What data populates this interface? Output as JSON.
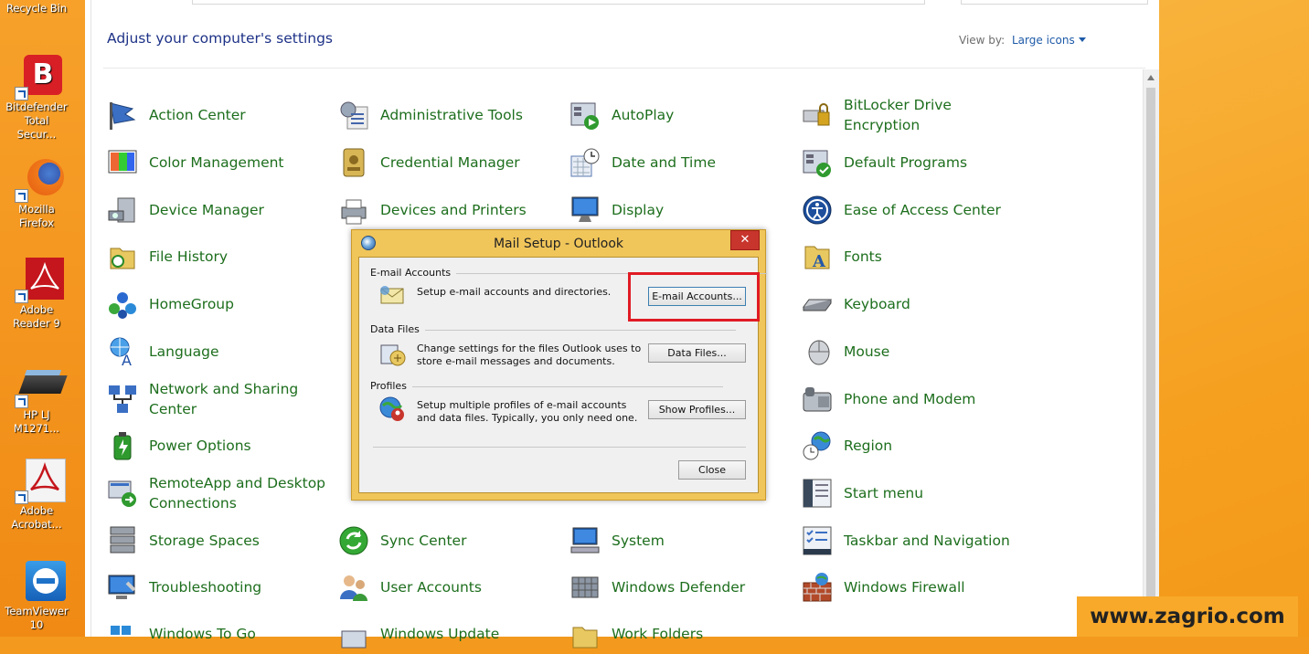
{
  "desktop": {
    "icons": [
      {
        "label": "Recycle Bin",
        "name": "recycle-bin-icon"
      },
      {
        "label": "Bitdefender Total Secur...",
        "name": "bitdefender-icon"
      },
      {
        "label": "Mozilla Firefox",
        "name": "firefox-icon"
      },
      {
        "label": "Adobe Reader 9",
        "name": "adobe-reader-icon"
      },
      {
        "label": "HP LJ M1271...",
        "name": "hp-scanner-icon"
      },
      {
        "label": "Adobe Acrobat...",
        "name": "adobe-acrobat-icon"
      },
      {
        "label": "TeamViewer 10",
        "name": "teamviewer-icon"
      }
    ]
  },
  "control_panel": {
    "heading": "Adjust your computer's settings",
    "view_by_label": "View by:",
    "view_mode": "Large icons",
    "items": [
      {
        "label": "Action Center",
        "icon": "flag-icon"
      },
      {
        "label": "Administrative Tools",
        "icon": "tools-icon"
      },
      {
        "label": "AutoPlay",
        "icon": "autoplay-icon"
      },
      {
        "label": "BitLocker Drive Encryption",
        "icon": "bitlocker-icon"
      },
      {
        "label": "Color Management",
        "icon": "color-management-icon"
      },
      {
        "label": "Credential Manager",
        "icon": "credential-icon"
      },
      {
        "label": "Date and Time",
        "icon": "calendar-clock-icon"
      },
      {
        "label": "Default Programs",
        "icon": "default-programs-icon"
      },
      {
        "label": "Device Manager",
        "icon": "device-manager-icon"
      },
      {
        "label": "Devices and Printers",
        "icon": "printer-icon"
      },
      {
        "label": "Display",
        "icon": "monitor-icon"
      },
      {
        "label": "Ease of Access Center",
        "icon": "ease-of-access-icon"
      },
      {
        "label": "File History",
        "icon": "folder-history-icon"
      },
      {
        "label": "",
        "icon": "hidden-icon"
      },
      {
        "label": "",
        "icon": "hidden-icon"
      },
      {
        "label": "Fonts",
        "icon": "fonts-icon"
      },
      {
        "label": "HomeGroup",
        "icon": "homegroup-icon"
      },
      {
        "label": "",
        "icon": "hidden-icon"
      },
      {
        "label": "",
        "icon": "hidden-icon"
      },
      {
        "label": "Keyboard",
        "icon": "keyboard-icon"
      },
      {
        "label": "Language",
        "icon": "language-icon"
      },
      {
        "label": "",
        "icon": "hidden-icon"
      },
      {
        "label": "",
        "icon": "hidden-icon"
      },
      {
        "label": "Mouse",
        "icon": "mouse-icon"
      },
      {
        "label": "Network and Sharing Center",
        "icon": "network-icon"
      },
      {
        "label": "",
        "icon": "hidden-icon"
      },
      {
        "label": "",
        "icon": "hidden-icon"
      },
      {
        "label": "Phone and Modem",
        "icon": "phone-icon"
      },
      {
        "label": "Power Options",
        "icon": "battery-icon"
      },
      {
        "label": "",
        "icon": "hidden-icon"
      },
      {
        "label": "",
        "icon": "hidden-icon"
      },
      {
        "label": "Region",
        "icon": "globe-clock-icon"
      },
      {
        "label": "RemoteApp and Desktop Connections",
        "icon": "remoteapp-icon"
      },
      {
        "label": "",
        "icon": "hidden-icon"
      },
      {
        "label": "",
        "icon": "hidden-icon"
      },
      {
        "label": "Start menu",
        "icon": "start-menu-icon"
      },
      {
        "label": "Storage Spaces",
        "icon": "storage-icon"
      },
      {
        "label": "Sync Center",
        "icon": "sync-icon"
      },
      {
        "label": "System",
        "icon": "system-icon"
      },
      {
        "label": "Taskbar and Navigation",
        "icon": "taskbar-icon"
      },
      {
        "label": "Troubleshooting",
        "icon": "troubleshoot-icon"
      },
      {
        "label": "User Accounts",
        "icon": "users-icon"
      },
      {
        "label": "Windows Defender",
        "icon": "defender-icon"
      },
      {
        "label": "Windows Firewall",
        "icon": "firewall-icon"
      },
      {
        "label": "Windows To Go",
        "icon": "windows-to-go-icon"
      },
      {
        "label": "Windows Update",
        "icon": "windows-update-icon"
      },
      {
        "label": "Work Folders",
        "icon": "work-folders-icon"
      }
    ]
  },
  "dialog": {
    "title": "Mail Setup - Outlook",
    "close_glyph": "✕",
    "sections": [
      {
        "group": "E-mail Accounts",
        "text": "Setup e-mail accounts and directories.",
        "button": "E-mail Accounts..."
      },
      {
        "group": "Data Files",
        "text": "Change settings for the files Outlook uses to store e-mail messages and documents.",
        "button": "Data Files..."
      },
      {
        "group": "Profiles",
        "text": "Setup multiple profiles of e-mail accounts and data files. Typically, you only need one.",
        "button": "Show Profiles..."
      }
    ],
    "close_button": "Close"
  },
  "watermark": "www.zagrio.com",
  "colors": {
    "link_green": "#1d6e1d",
    "heading_blue": "#1e3287",
    "dialog_frame": "#f0c55a",
    "highlight_red": "#e01b24"
  }
}
